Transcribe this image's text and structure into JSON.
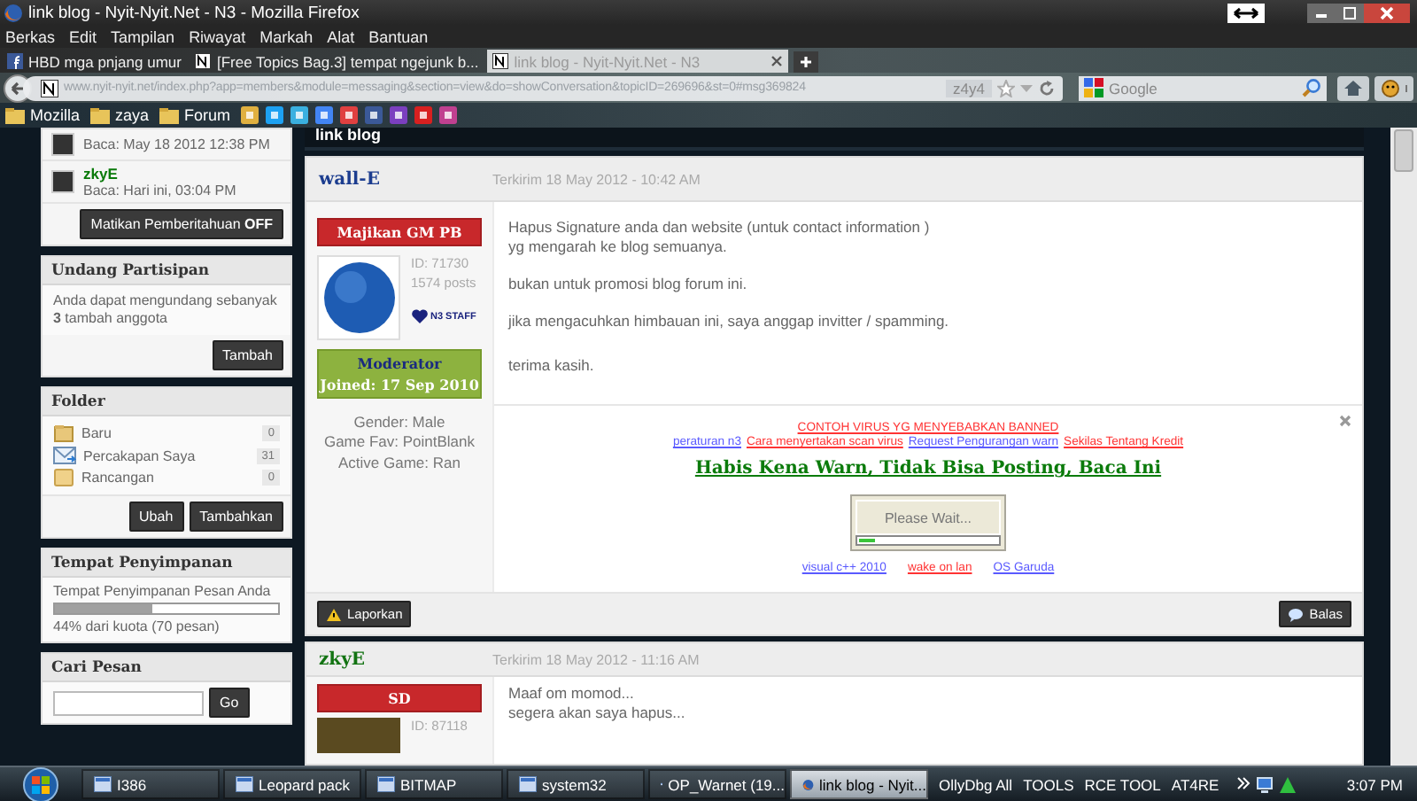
{
  "window": {
    "title": "link blog - Nyit-Nyit.Net - N3 - Mozilla Firefox"
  },
  "menu": [
    "Berkas",
    "Edit",
    "Tampilan",
    "Riwayat",
    "Markah",
    "Alat",
    "Bantuan"
  ],
  "tabs": [
    {
      "label": "HBD mga pnjang umur",
      "selected": false
    },
    {
      "label": "[Free Topics Bag.3] tempat ngejunk b...",
      "selected": false
    },
    {
      "label": "link blog - Nyit-Nyit.Net - N3",
      "selected": true
    }
  ],
  "address_bar": {
    "url": "www.nyit-nyit.net/index.php?app=members&module=messaging&section=view&do=showConversation&topicID=269696&st=0#msg369824",
    "badge": "z4y4"
  },
  "search": {
    "placeholder": "Google"
  },
  "bookmarks": [
    "Mozilla",
    "zaya",
    "Forum"
  ],
  "sidebar": {
    "participants": [
      {
        "read": "Baca: May 18 2012 12:38 PM"
      },
      {
        "name": "zkyE",
        "read": "Baca: Hari ini, 03:04 PM"
      }
    ],
    "notify_button": "Matikan Pemberitahuan **OFF**",
    "invite": {
      "title": "Undang Partisipan",
      "text": "Anda dapat mengundang sebanyak **3** tambah anggota",
      "button": "Tambah"
    },
    "folders": {
      "title": "Folder",
      "items": [
        {
          "kind": "folder",
          "name": "Baru",
          "count": "0"
        },
        {
          "kind": "mail",
          "name": "Percakapan Saya",
          "count": "31"
        },
        {
          "kind": "draft",
          "name": "Rancangan",
          "count": "0"
        }
      ],
      "buttons": [
        "Ubah",
        "Tambahkan"
      ]
    },
    "storage": {
      "title": "Tempat Penyimpanan",
      "label": "Tempat Penyimpanan Pesan Anda",
      "level": 0.44,
      "reading": "44% dari kuota (70 pesan)"
    },
    "message_search": {
      "title": "Cari Pesan",
      "button": "Go"
    }
  },
  "topic": {
    "title": "link blog"
  },
  "posts": [
    {
      "author": "wall-E",
      "sent": "Terkirim 18 May 2012 - 10:42 AM",
      "rank": "Majikan GM PB",
      "id": "ID: 71730",
      "post_count": "1574 posts",
      "staff_badge": "N3 STAFF",
      "group": "Moderator",
      "joined": "Joined: 17 Sep 2010",
      "profile": [
        "Gender: Male",
        "Game Fav: PointBlank",
        "Active Game: Ran"
      ],
      "body": [
        [
          "Hapus Signature anda dan website (untuk contact information )",
          "yg mengarah ke blog semuanya."
        ],
        [
          "bukan untuk promosi blog forum ini."
        ],
        [
          "jika mengacuhkan himbauan ini, saya anggap invitter / spamming."
        ],
        [
          "terima kasih."
        ]
      ],
      "signature": {
        "title_link": {
          "text": "CONTOH VIRUS YG MENYEBABKAN BANNED",
          "color": "#ff3333"
        },
        "links": [
          {
            "text": "peraturan n3",
            "color": "#5a5aff"
          },
          {
            "text": "Cara menyertakan scan virus",
            "color": "#ff3333"
          },
          {
            "text": "Request Pengurangan warn",
            "color": "#5a5aff"
          },
          {
            "text": "Sekilas Tentang Kredit",
            "color": "#ff3333"
          }
        ],
        "heading": "Habis Kena Warn, Tidak Bisa Posting, Baca Ini",
        "progress": {
          "label": "Please Wait...",
          "level": 0.12
        },
        "footer_links": [
          {
            "text": "visual c++ 2010",
            "color": "#5a5aff"
          },
          {
            "text": "wake on lan",
            "color": "#ff3333"
          },
          {
            "text": "OS Garuda",
            "color": "#5a5aff"
          }
        ]
      },
      "actions": {
        "report": "Laporkan",
        "reply": "Balas"
      }
    },
    {
      "author": "zkyE",
      "sent": "Terkirim 18 May 2012 - 11:16 AM",
      "rank": "SD",
      "id": "ID: 87118",
      "body": [
        [
          "Maaf om momod...",
          "segera akan saya hapus..."
        ]
      ]
    }
  ],
  "taskbar": {
    "items": [
      {
        "label": "I386",
        "selected": false
      },
      {
        "label": "Leopard pack",
        "selected": false
      },
      {
        "label": "BITMAP",
        "selected": false
      },
      {
        "label": "system32",
        "selected": false
      },
      {
        "label": "OP_Warnet (19...",
        "selected": false
      },
      {
        "label": "link blog - Nyit...",
        "selected": true
      }
    ],
    "toolbars": [
      "OllyDbg All",
      "TOOLS",
      "RCE TOOL",
      "AT4RE"
    ],
    "clock": "3:07 PM"
  }
}
